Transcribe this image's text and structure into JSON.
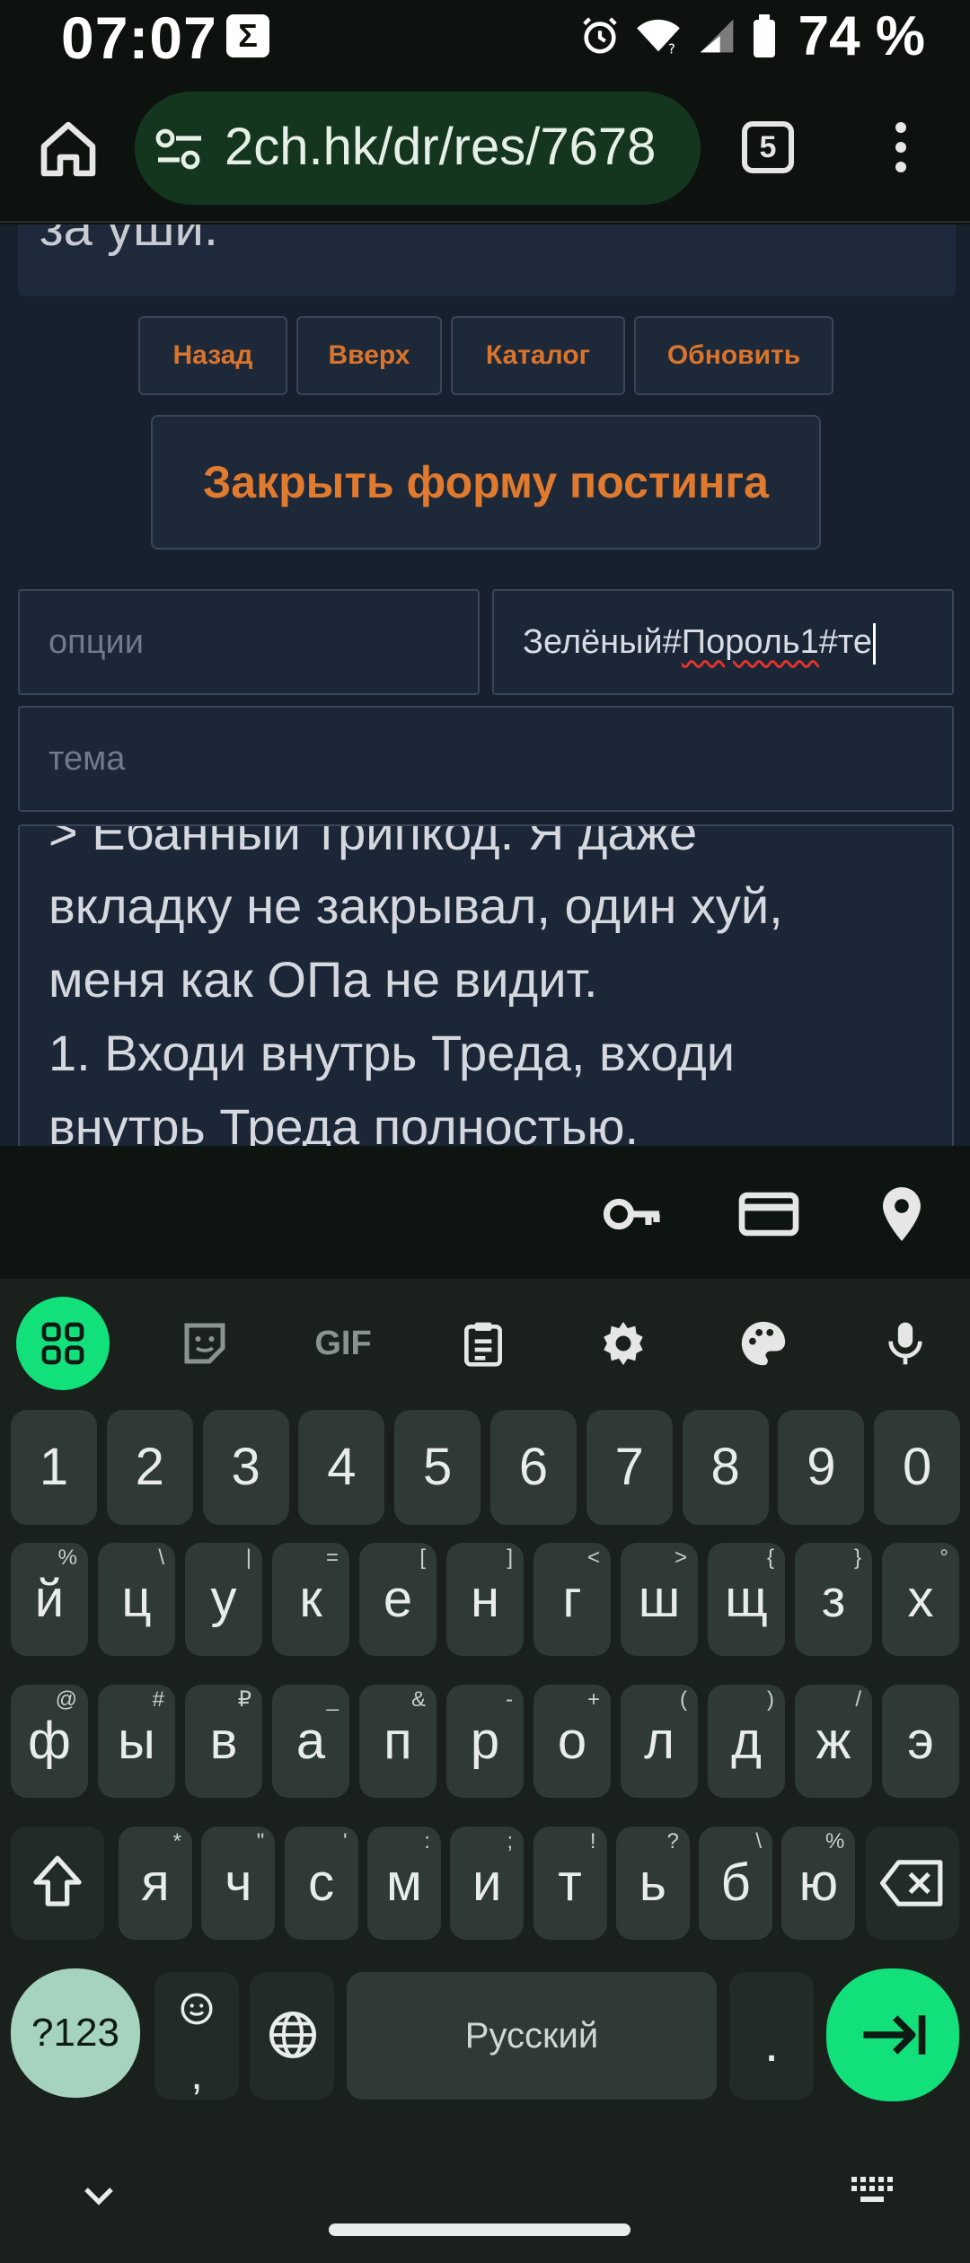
{
  "status_bar": {
    "time": "07:07",
    "sigma": "Σ",
    "battery": "74 %"
  },
  "browser": {
    "url": "2ch.hk/dr/res/7678",
    "tab_count": "5"
  },
  "page": {
    "prev_post_text": "за уши.",
    "nav_buttons": [
      "Назад",
      "Вверх",
      "Каталог",
      "Обновить"
    ],
    "close_form_label": "Закрыть форму постинга",
    "options_placeholder": "опции",
    "name_value_pre": "Зелёный#",
    "name_value_squig": "Пороль1",
    "name_value_post": "#те",
    "subject_placeholder": "тема",
    "comment_lines": [
      "> Ебанный трипкод. Я даже",
      "вкладку не закрывал, один хуй,",
      "меня как ОПа не видит.",
      "1. Входи внутрь Треда, входи",
      "внутрь Треда полностью."
    ]
  },
  "keyboard": {
    "numbers": [
      "1",
      "2",
      "3",
      "4",
      "5",
      "6",
      "7",
      "8",
      "9",
      "0"
    ],
    "row1": [
      {
        "k": "й",
        "h": "%"
      },
      {
        "k": "ц",
        "h": "\\"
      },
      {
        "k": "у",
        "h": "|"
      },
      {
        "k": "к",
        "h": "="
      },
      {
        "k": "е",
        "h": "["
      },
      {
        "k": "н",
        "h": "]"
      },
      {
        "k": "г",
        "h": "<"
      },
      {
        "k": "ш",
        "h": ">"
      },
      {
        "k": "щ",
        "h": "{"
      },
      {
        "k": "з",
        "h": "}"
      },
      {
        "k": "х",
        "h": "°"
      }
    ],
    "row2": [
      {
        "k": "ф",
        "h": "@"
      },
      {
        "k": "ы",
        "h": "#"
      },
      {
        "k": "в",
        "h": "₽"
      },
      {
        "k": "а",
        "h": "_"
      },
      {
        "k": "п",
        "h": "&"
      },
      {
        "k": "р",
        "h": "-"
      },
      {
        "k": "о",
        "h": "+"
      },
      {
        "k": "л",
        "h": "("
      },
      {
        "k": "д",
        "h": ")"
      },
      {
        "k": "ж",
        "h": "/"
      },
      {
        "k": "э",
        "h": ""
      }
    ],
    "row3": [
      {
        "k": "я",
        "h": "*"
      },
      {
        "k": "ч",
        "h": "\""
      },
      {
        "k": "с",
        "h": "'"
      },
      {
        "k": "м",
        "h": ":"
      },
      {
        "k": "и",
        "h": ";"
      },
      {
        "k": "т",
        "h": "!"
      },
      {
        "k": "ь",
        "h": "?"
      },
      {
        "k": "б",
        "h": "\\"
      },
      {
        "k": "ю",
        "h": "%"
      }
    ],
    "symbols_label": "?123",
    "comma_label": ",",
    "space_label": "Русский",
    "period_label": ".",
    "gif_label": "GIF"
  },
  "colors": {
    "accent_green": "#12e07b",
    "page_bg": "#16202f",
    "link_orange": "#d9742c"
  }
}
